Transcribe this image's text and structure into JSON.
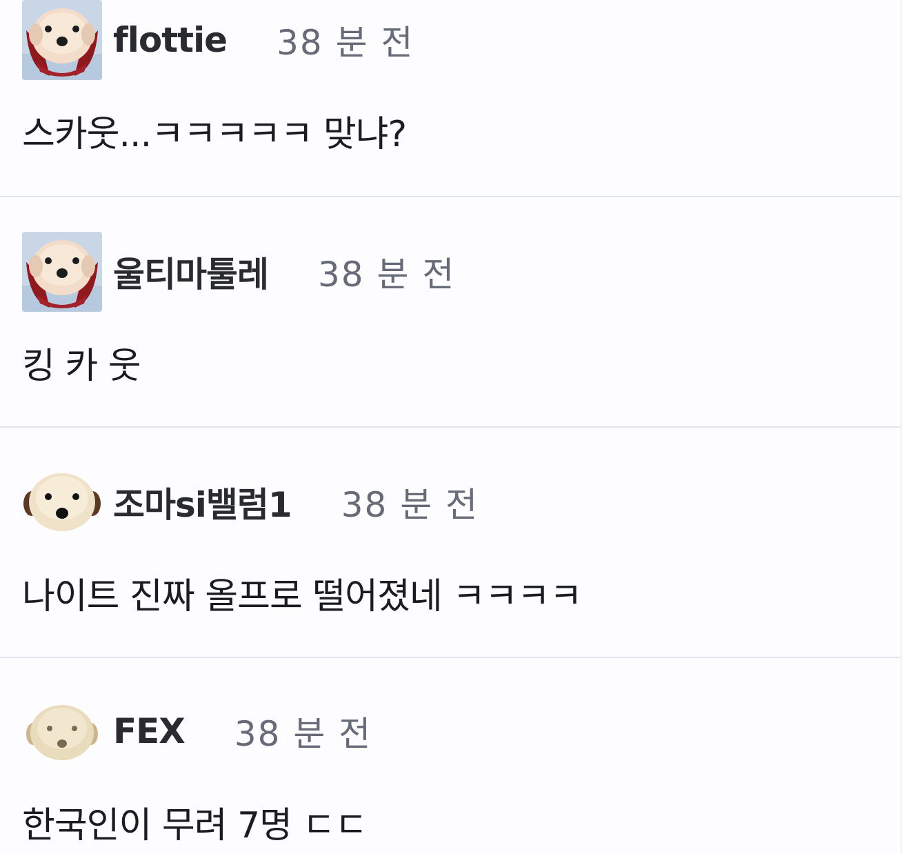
{
  "comments": [
    {
      "avatar_icon": "puppy-face-red-scarf-icon",
      "username": "flottie",
      "timestamp": "38 분 전",
      "text": "스카웃...ㅋㅋㅋㅋㅋ 맞냐?"
    },
    {
      "avatar_icon": "puppy-face-red-scarf-icon",
      "username": "울티마툴레",
      "timestamp": "38 분 전",
      "text": "킹 카 웃"
    },
    {
      "avatar_icon": "puppy-face-round-icon",
      "username": "조마si밸럼1",
      "timestamp": "38 분 전",
      "text": "나이트 진짜 올프로 떨어졌네 ㅋㅋㅋㅋ"
    },
    {
      "avatar_icon": "puppy-face-round-faded-icon",
      "username": "FEX",
      "timestamp": "38 분 전",
      "text": "한국인이 무려 7명 ㄷㄷ"
    }
  ],
  "colors": {
    "card_background": "#fdfdff",
    "divider": "#e2e5ef",
    "username": "#2a2b30",
    "timestamp": "#676b78",
    "text": "#1b1c20",
    "scarf": "#9b1c22"
  }
}
